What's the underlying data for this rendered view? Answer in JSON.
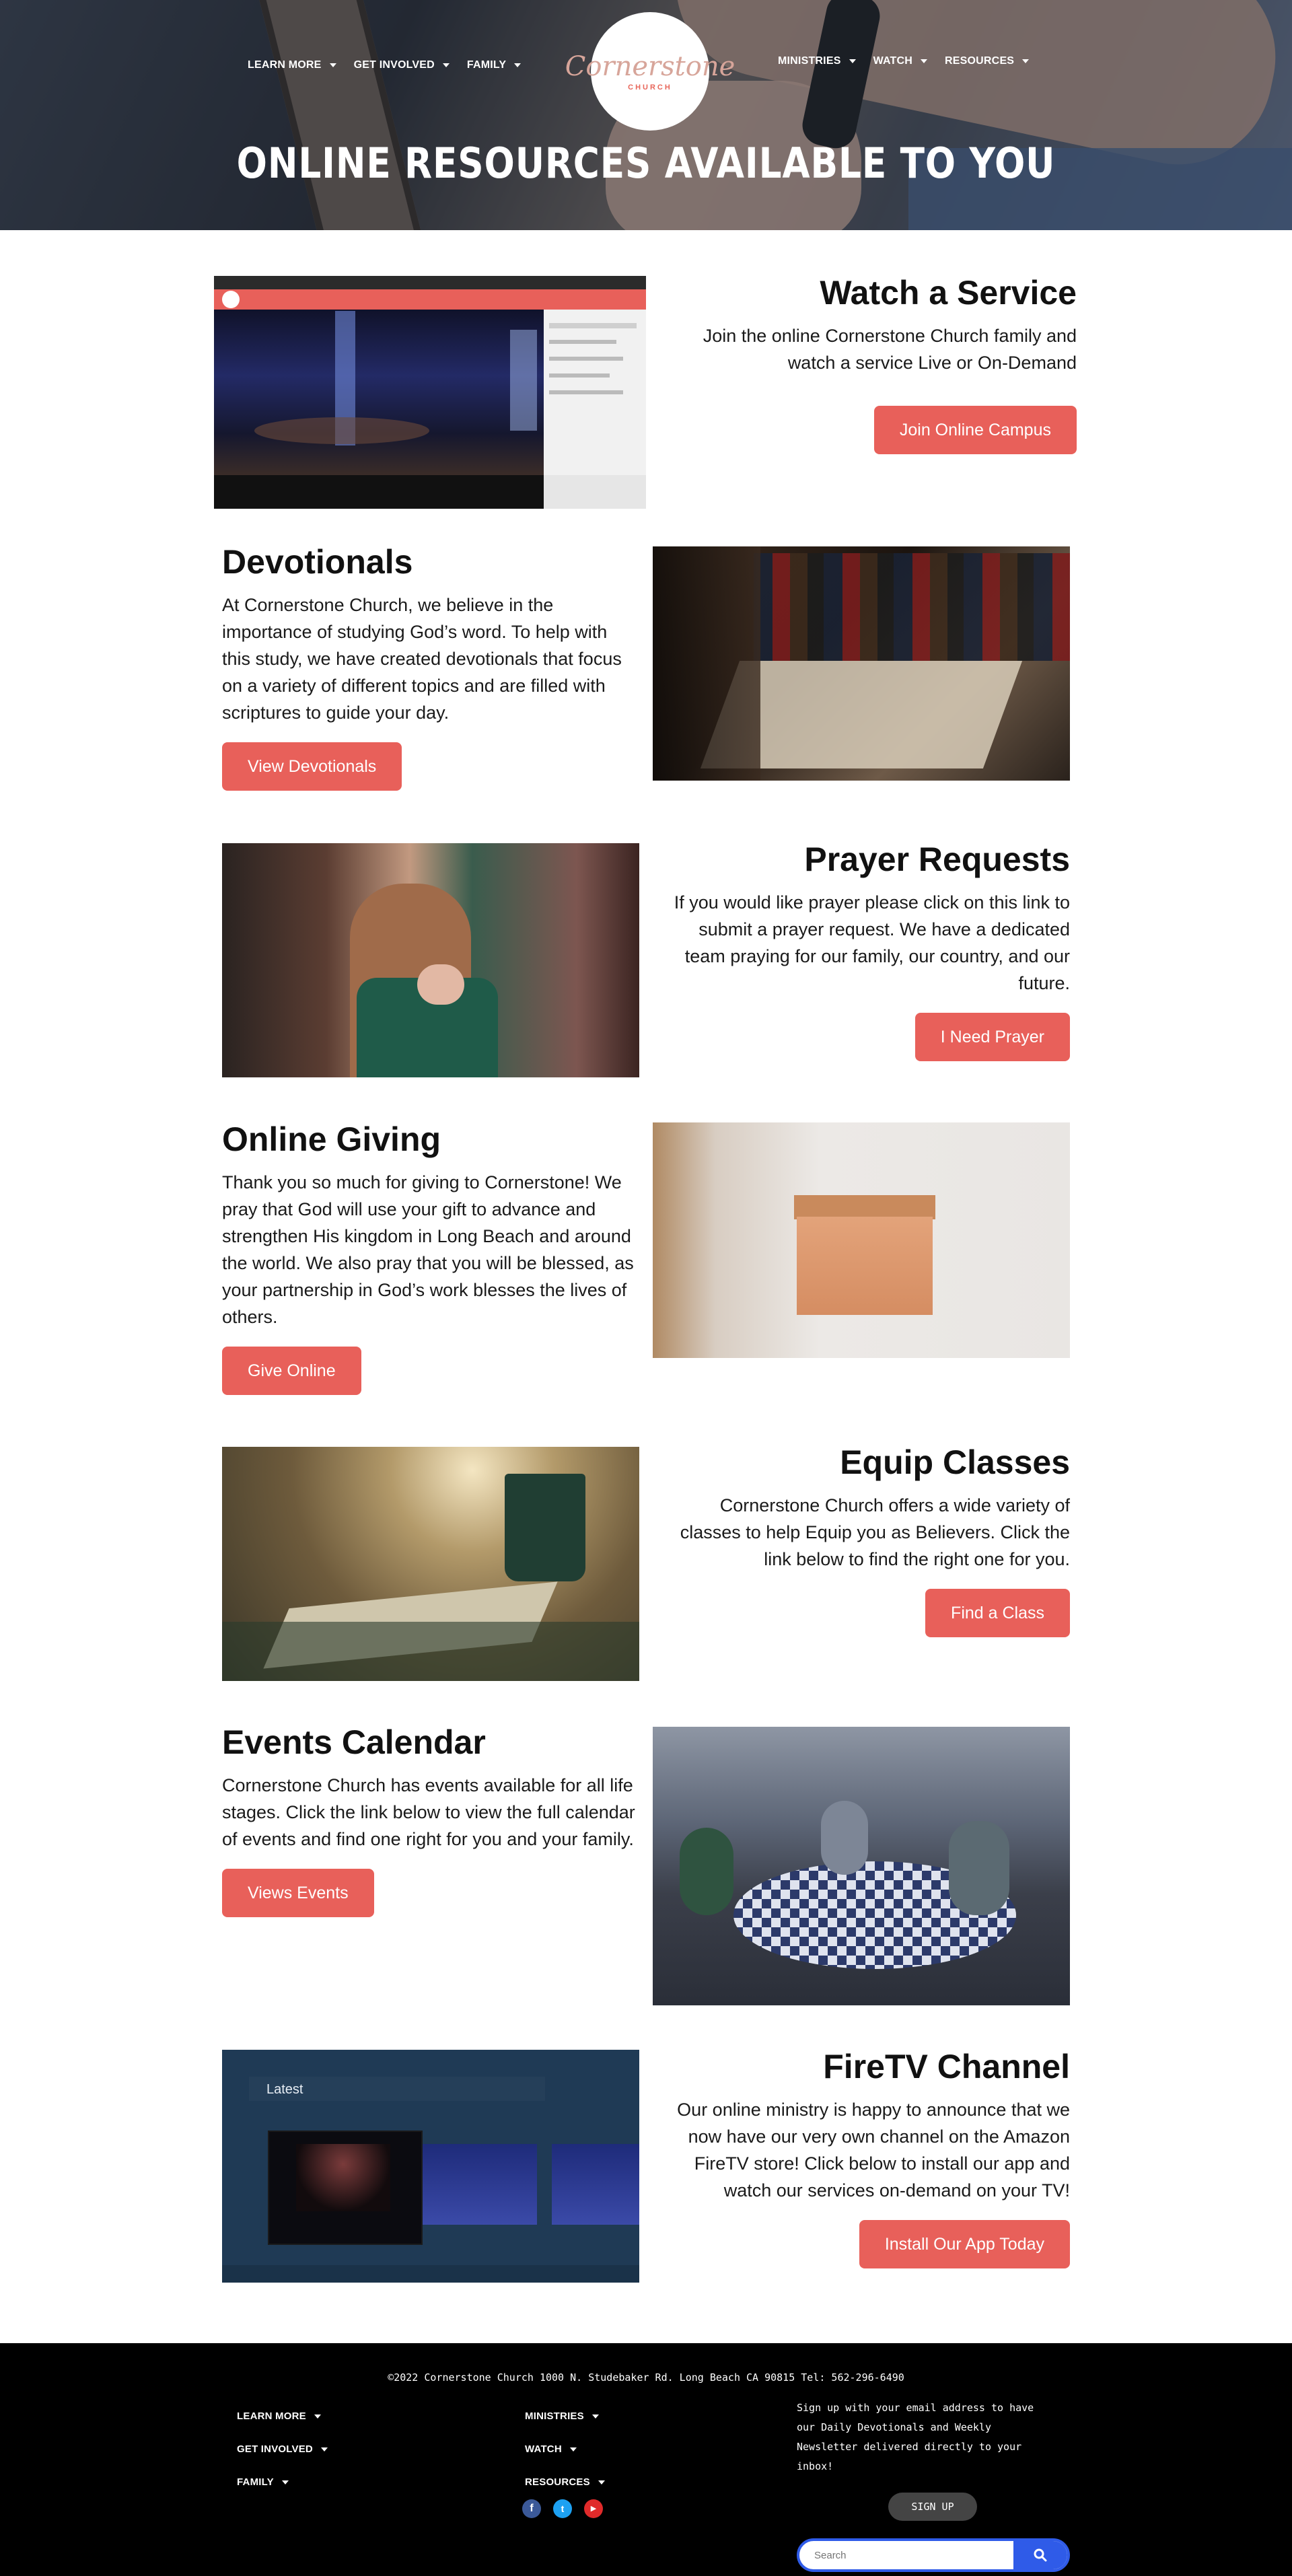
{
  "nav": {
    "left": [
      {
        "label": "LEARN MORE"
      },
      {
        "label": "GET INVOLVED"
      },
      {
        "label": "FAMILY"
      }
    ],
    "right": [
      {
        "label": "MINISTRIES"
      },
      {
        "label": "WATCH"
      },
      {
        "label": "RESOURCES"
      }
    ]
  },
  "logo": {
    "script": "Cornerstone",
    "small": "CHURCH"
  },
  "hero": {
    "title": "ONLINE RESOURCES AVAILABLE TO YOU"
  },
  "sections": [
    {
      "title": "Watch a Service",
      "text": "Join the online Cornerstone Church family and watch a service Live or On-Demand",
      "button": "Join Online Campus"
    },
    {
      "title": "Devotionals",
      "text": "At Cornerstone Church, we believe in the importance of studying God’s word. To help with this study, we have created devotionals that focus on a variety of different topics and are filled with scriptures to guide your day.",
      "button": "View Devotionals"
    },
    {
      "title": "Prayer Requests",
      "text": "If you would like prayer please click on this link to submit a prayer request. We have a dedicated team praying for our family, our country, and our future.",
      "button": "I Need Prayer"
    },
    {
      "title": "Online Giving",
      "text": "Thank you so much for giving to Cornerstone! We pray that God will use your gift to advance and strengthen His kingdom in Long Beach and around the world. We also pray that you will be blessed, as your partnership in God’s work blesses the lives of others.",
      "button": "Give Online"
    },
    {
      "title": "Equip Classes",
      "text": "Cornerstone Church offers a wide variety of classes to help Equip you as Believers. Click the link below to find the right one for you.",
      "button": "Find a Class"
    },
    {
      "title": "Events Calendar",
      "text": "Cornerstone Church has events available for all life stages. Click the link below to view the full calendar of events and find one right for you and your family.",
      "button": "Views Events"
    },
    {
      "title": "FireTV Channel",
      "text": "Our online ministry is happy to announce that we now have our very own channel on the Amazon FireTV store! Click below to install our app and watch our services on-demand on your TV!",
      "button": "Install Our App Today"
    }
  ],
  "firetv_image": {
    "latest_label": "Latest"
  },
  "footer": {
    "copyright": "©2022 Cornerstone Church 1000 N. Studebaker Rd. Long Beach CA 90815 Tel: 562-296-6490",
    "col1": [
      {
        "label": "LEARN MORE"
      },
      {
        "label": "GET INVOLVED"
      },
      {
        "label": "FAMILY"
      }
    ],
    "col2": [
      {
        "label": "MINISTRIES"
      },
      {
        "label": "WATCH"
      },
      {
        "label": "RESOURCES"
      }
    ],
    "signup_text": "Sign up with your email address to have our Daily Devotionals and Weekly Newsletter delivered directly to your inbox!",
    "signup_button": "SIGN UP",
    "search_placeholder": "Search",
    "social_icons": [
      "facebook-icon",
      "twitter-icon",
      "youtube-icon"
    ]
  },
  "colors": {
    "accent": "#e8605a",
    "footer_bg": "#000000",
    "search_button": "#2f5be8"
  }
}
